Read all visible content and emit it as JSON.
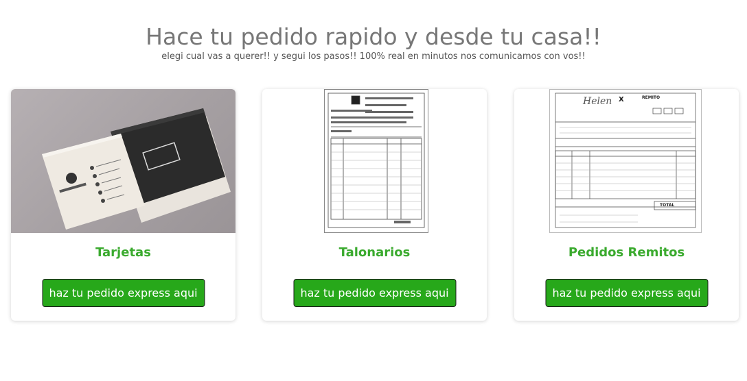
{
  "header": {
    "title": "Hace tu pedido rapido y desde tu casa!!",
    "subtitle": "elegi cual vas a querer!! y segui los pasos!! 100% real en minutos nos comunicamos con vos!!"
  },
  "cards": [
    {
      "name": "Tarjetas",
      "button": "haz tu pedido express aqui",
      "image_name": "business-cards-image"
    },
    {
      "name": "Talonarios",
      "button": "haz tu pedido express aqui",
      "image_name": "receipt-book-image"
    },
    {
      "name": "Pedidos Remitos",
      "button": "haz tu pedido express aqui",
      "image_name": "delivery-note-image"
    }
  ],
  "colors": {
    "accent": "#27a81a",
    "card_title": "#3aaa2e",
    "heading": "#777777"
  }
}
